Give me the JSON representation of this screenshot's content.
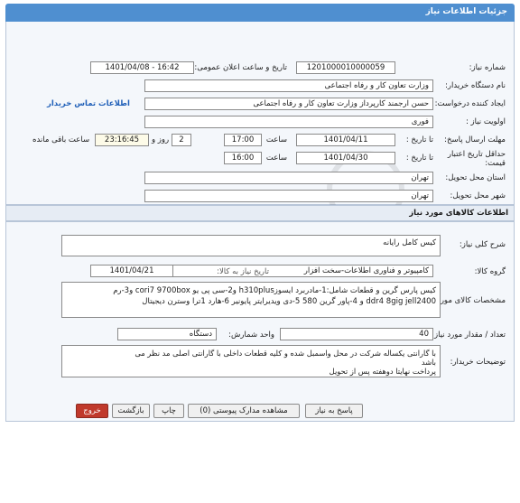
{
  "header": {
    "title": "جزئیات اطلاعات نیاز"
  },
  "form": {
    "need_number_label": "شماره نیاز:",
    "need_number": "1201000010000059",
    "announce_label": "تاریخ و ساعت اعلان عمومی:",
    "announce_value": "1401/04/08 - 16:42",
    "buyer_org_label": "نام دستگاه خریدار:",
    "buyer_org": "وزارت تعاون کار و رفاه اجتماعی",
    "requester_label": "ایجاد کننده درخواست:",
    "requester": "حسن ارجمند کارپرداز وزارت تعاون کار و رفاه اجتماعی",
    "contact_link": "اطلاعات تماس خریدار",
    "priority_label": "اولویت نیاز :",
    "priority": "فوری",
    "reply_deadline_label": "مهلت ارسال پاسخ:",
    "until_date_label": "تا تاریخ :",
    "reply_date": "1401/04/11",
    "time_label": "ساعت",
    "reply_time": "17:00",
    "days": "2",
    "days_label": "روز و",
    "remaining_time": "23:16:45",
    "remaining_label": "ساعت باقی مانده",
    "min_validity_label": "حداقل تاریخ اعتبار قیمت:",
    "validity_until_label": "تا تاریخ :",
    "validity_date": "1401/04/30",
    "validity_time_label": "ساعت",
    "validity_time": "16:00",
    "province_label": "استان محل تحویل:",
    "province": "تهران",
    "city_label": "شهر محل تحویل:",
    "city": "تهران"
  },
  "goods": {
    "section_title": "اطلاعات کالاهای مورد نیاز",
    "summary_label": "شرح کلی نیاز:",
    "summary": "کیس کامل رایانه",
    "group_label": "گروه کالا:",
    "group": "کامپیوتر و فناوری اطلاعات-سخت افزار",
    "need_date_label": "تاریخ نیاز به کالا:",
    "need_date": "1401/04/21",
    "specs_label": "مشخصات کالای مورد نیاز:",
    "specs_line1": "کیس  پارس گرین و قطعات شامل:1-مادربرد ایسوزh310plus  و2-سی پی یو cori7 9700box و3-رم",
    "specs_line2": "ddr4 8gig jell2400 و 4-پاور گرین 580  5-دی ویدیرایتر پایونیر  6-هارد 1ترا وسترن دیجیتال",
    "qty_label": "تعداد / مقدار مورد نیاز:",
    "qty": "40",
    "unit_label": "واحد شمارش:",
    "unit": "دستگاه",
    "buyer_notes_label": "توضیحات خریدار:",
    "notes_line1": "با گارانتی یکساله شرکت در محل واسمبل شده  و کلیه قطعات داخلی با گارانتی اصلی مد نظر می",
    "notes_line2": "باشد",
    "notes_line3": "پرداخت نهایتا دوهفته پس از تحویل"
  },
  "buttons": {
    "reply": "پاسخ به نیاز",
    "attachments": "مشاهده مدارک پیوستی (0)",
    "print": "چاپ",
    "back": "بازگشت",
    "exit": "خروج"
  },
  "colors": {
    "header_bg": "#4f8fd0",
    "exit_button": "#c0392b",
    "link": "#1f5fb8"
  }
}
